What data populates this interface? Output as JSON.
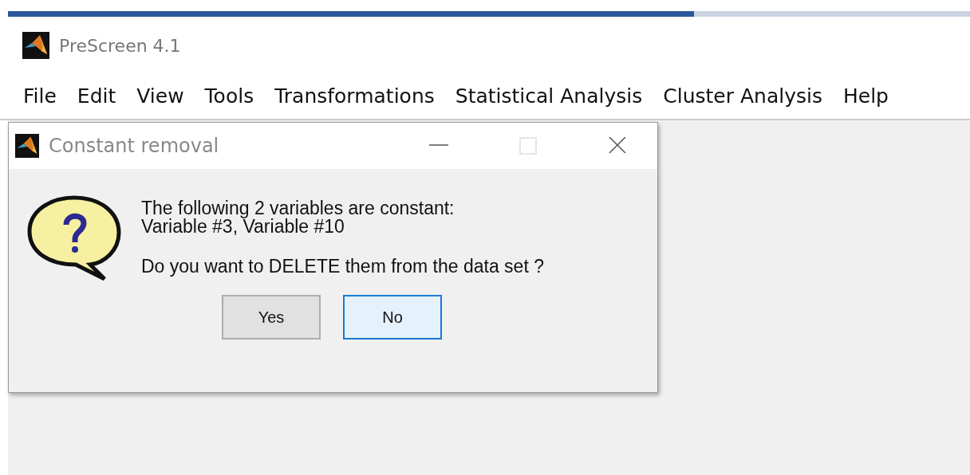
{
  "app": {
    "title": "PreScreen 4.1"
  },
  "menu": [
    {
      "label": "File"
    },
    {
      "label": "Edit"
    },
    {
      "label": "View"
    },
    {
      "label": "Tools"
    },
    {
      "label": "Transformations"
    },
    {
      "label": "Statistical Analysis"
    },
    {
      "label": "Cluster Analysis"
    },
    {
      "label": "Help"
    }
  ],
  "dialog": {
    "title": "Constant removal",
    "lines": [
      "The following 2 variables are constant:",
      "Variable #3, Variable #10"
    ],
    "question": "Do you want to DELETE them from the data set ?",
    "buttons": [
      {
        "label": "Yes",
        "default": false
      },
      {
        "label": "No",
        "default": true
      }
    ]
  }
}
